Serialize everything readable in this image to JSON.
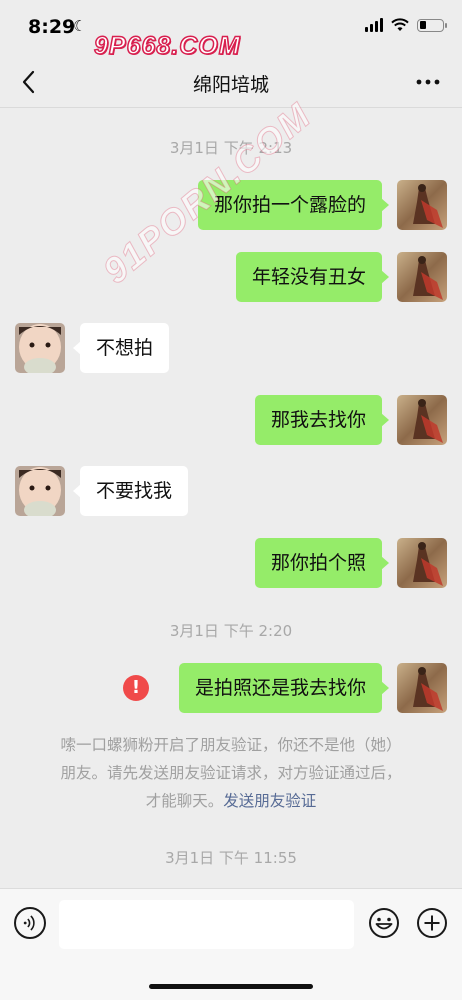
{
  "status_bar": {
    "time": "8:29",
    "battery_level": 0.3
  },
  "watermarks": {
    "top": "9P668.COM",
    "diagonal": "91PORN.COM"
  },
  "nav": {
    "title": "绵阳培城"
  },
  "timestamps": [
    "3月1日 下午 2:13",
    "3月1日 下午 2:20",
    "3月1日 下午 11:55"
  ],
  "messages": [
    {
      "side": "right",
      "text": "那你拍一个露脸的"
    },
    {
      "side": "right",
      "text": "年轻没有丑女"
    },
    {
      "side": "left",
      "text": "不想拍"
    },
    {
      "side": "right",
      "text": "那我去找你"
    },
    {
      "side": "left",
      "text": "不要找我"
    },
    {
      "side": "right",
      "text": "那你拍个照"
    },
    {
      "side": "right",
      "text": "是拍照还是我去找你",
      "error": true,
      "error_glyph": "!"
    }
  ],
  "system_notice": {
    "line1": "嗦一口螺狮粉开启了朋友验证，你还不是他（她）",
    "line2": "朋友。请先发送朋友验证请求，对方验证通过后，",
    "line3": "才能聊天。",
    "link": "发送朋友验证"
  },
  "colors": {
    "self_bubble": "#95ec69",
    "other_bubble": "#ffffff",
    "link": "#576b95",
    "error": "#f04a4a"
  }
}
